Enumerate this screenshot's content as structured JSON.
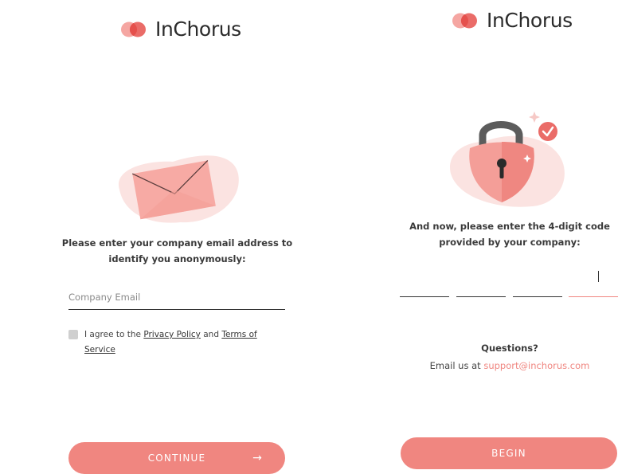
{
  "brand": {
    "name": "InChorus",
    "accent": "#f08680"
  },
  "email_screen": {
    "prompt_line1": "Please enter your company email address to",
    "prompt_line2": "identify you anonymously:",
    "email_placeholder": "Company Email",
    "agree_prefix": "I agree to the ",
    "privacy_link": "Privacy Policy",
    "agree_and": " and ",
    "terms_link": "Terms of Service",
    "continue_label": "CONTINUE",
    "continue_icon": "arrow-right-icon"
  },
  "code_screen": {
    "prompt_line1": "And now, please enter the 4-digit code",
    "prompt_line2": "provided by your company:",
    "code_digits": [
      "",
      "",
      "",
      ""
    ],
    "questions_label": "Questions?",
    "email_prefix": "Email us at ",
    "support_email": "support@inchorus.com",
    "begin_label": "BEGIN"
  }
}
